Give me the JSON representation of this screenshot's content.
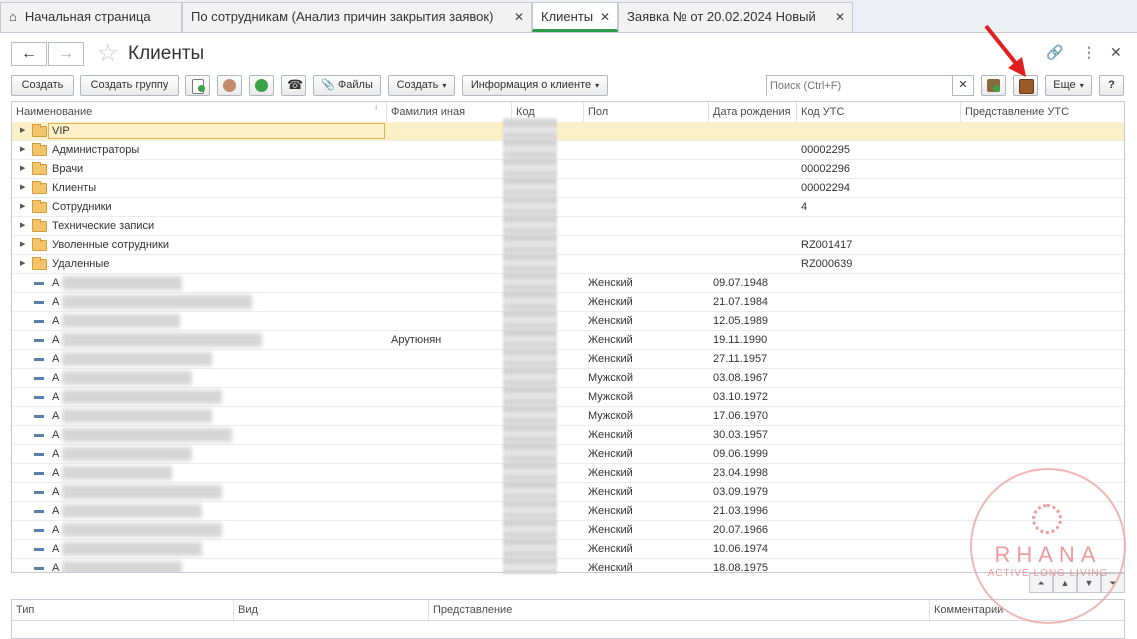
{
  "tabs": [
    {
      "label": "Начальная страница",
      "closable": false
    },
    {
      "label": "По сотрудникам (Анализ причин закрытия заявок)",
      "closable": true
    },
    {
      "label": "Клиенты",
      "closable": true,
      "active": true
    },
    {
      "label": "Заявка №  от 20.02.2024 Новый",
      "closable": true
    }
  ],
  "header": {
    "title": "Клиенты",
    "back": "←",
    "forward": "→"
  },
  "toolbar": {
    "create": "Создать",
    "create_group": "Создать группу",
    "files": "Файлы",
    "create_menu": "Создать",
    "client_info": "Информация о клиенте",
    "search_placeholder": "Поиск (Ctrl+F)",
    "more": "Еще",
    "help": "?"
  },
  "columns": [
    "Наименование",
    "Фамилия иная",
    "Код",
    "Пол",
    "Дата рождения",
    "Код УТС",
    "Представление УТС"
  ],
  "groups": [
    {
      "name": "VIP",
      "uts": ""
    },
    {
      "name": "Администраторы",
      "uts": "00002295"
    },
    {
      "name": "Врачи",
      "uts": "00002296"
    },
    {
      "name": "Клиенты",
      "uts": "00002294"
    },
    {
      "name": "Сотрудники",
      "uts": "4"
    },
    {
      "name": "Технические записи",
      "uts": ""
    },
    {
      "name": "Уволенные сотрудники",
      "uts": "RZ001417"
    },
    {
      "name": "Удаленные",
      "uts": "RZ000639"
    }
  ],
  "clients": [
    {
      "name": "А",
      "other": "",
      "sex": "Женский",
      "dob": "09.07.1948"
    },
    {
      "name": "А",
      "other": "",
      "sex": "Женский",
      "dob": "21.07.1984"
    },
    {
      "name": "А",
      "other": "",
      "sex": "Женский",
      "dob": "12.05.1989"
    },
    {
      "name": "А",
      "other": "Арутюнян",
      "sex": "Женский",
      "dob": "19.11.1990"
    },
    {
      "name": "А",
      "other": "",
      "sex": "Женский",
      "dob": "27.11.1957"
    },
    {
      "name": "А",
      "other": "",
      "sex": "Мужской",
      "dob": "03.08.1967"
    },
    {
      "name": "А",
      "other": "",
      "sex": "Мужской",
      "dob": "03.10.1972"
    },
    {
      "name": "А",
      "other": "",
      "sex": "Мужской",
      "dob": "17.06.1970"
    },
    {
      "name": "А",
      "other": "",
      "sex": "Женский",
      "dob": "30.03.1957"
    },
    {
      "name": "А",
      "other": "",
      "sex": "Женский",
      "dob": "09.06.1999"
    },
    {
      "name": "А",
      "other": "",
      "sex": "Женский",
      "dob": "23.04.1998"
    },
    {
      "name": "А",
      "other": "",
      "sex": "Женский",
      "dob": "03.09.1979"
    },
    {
      "name": "А",
      "other": "",
      "sex": "Женский",
      "dob": "21.03.1996"
    },
    {
      "name": "А",
      "other": "",
      "sex": "Женский",
      "dob": "20.07.1966"
    },
    {
      "name": "А",
      "other": "",
      "sex": "Женский",
      "dob": "10.06.1974"
    },
    {
      "name": "А",
      "other": "",
      "sex": "Женский",
      "dob": "18.08.1975"
    }
  ],
  "bottom_columns": [
    "Тип",
    "Вид",
    "Представление",
    "Комментарии"
  ],
  "watermark": {
    "name": "RHANA",
    "slogan": "ACTIVE LONG LIVING"
  },
  "colors": {
    "accent": "#2e9b4a",
    "selection": "#fbf0c8",
    "folder": "#f3c46a",
    "arrow": "#e02020"
  }
}
